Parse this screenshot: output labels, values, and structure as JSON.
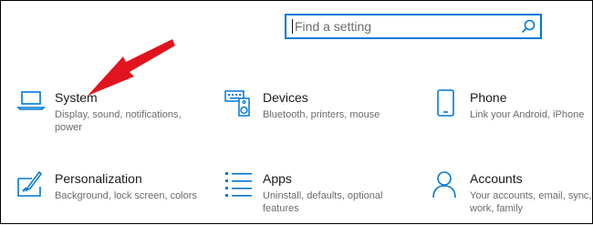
{
  "search": {
    "placeholder": "Find a setting",
    "value": ""
  },
  "colors": {
    "accent": "#0078d7",
    "annotation_arrow": "#e0141e"
  },
  "categories": [
    {
      "label": "System",
      "description": "Display, sound, notifications, power",
      "icon": "laptop-icon"
    },
    {
      "label": "Devices",
      "description": "Bluetooth, printers, mouse",
      "icon": "keyboard-speaker-icon"
    },
    {
      "label": "Phone",
      "description": "Link your Android, iPhone",
      "icon": "phone-icon"
    },
    {
      "label": "Personalization",
      "description": "Background, lock screen, colors",
      "icon": "paintbrush-icon"
    },
    {
      "label": "Apps",
      "description": "Uninstall, defaults, optional features",
      "icon": "list-icon"
    },
    {
      "label": "Accounts",
      "description": "Your accounts, email, sync, work, family",
      "icon": "person-icon"
    }
  ]
}
